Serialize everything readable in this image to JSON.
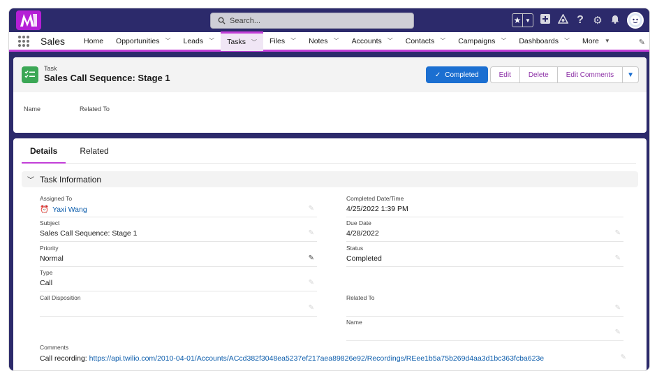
{
  "header": {
    "search_placeholder": "Search...",
    "icons": [
      "favorites-star-icon",
      "global-add-icon",
      "trailhead-icon",
      "help-icon",
      "setup-gear-icon",
      "notifications-bell-icon",
      "user-avatar"
    ]
  },
  "nav": {
    "app_name": "Sales",
    "items": [
      {
        "label": "Home",
        "dropdown": false
      },
      {
        "label": "Opportunities",
        "dropdown": true
      },
      {
        "label": "Leads",
        "dropdown": true
      },
      {
        "label": "Tasks",
        "dropdown": true,
        "active": true
      },
      {
        "label": "Files",
        "dropdown": true
      },
      {
        "label": "Notes",
        "dropdown": true
      },
      {
        "label": "Accounts",
        "dropdown": true
      },
      {
        "label": "Contacts",
        "dropdown": true
      },
      {
        "label": "Campaigns",
        "dropdown": true
      },
      {
        "label": "Dashboards",
        "dropdown": true
      },
      {
        "label": "More",
        "dropdown": true
      }
    ]
  },
  "record": {
    "object_label": "Task",
    "title": "Sales Call Sequence: Stage 1",
    "actions": {
      "completed": "Completed",
      "edit": "Edit",
      "delete": "Delete",
      "edit_comments": "Edit Comments"
    },
    "highlight_fields": [
      "Name",
      "Related To"
    ]
  },
  "tabs": [
    "Details",
    "Related"
  ],
  "section_title": "Task Information",
  "fields": {
    "assigned_to": {
      "label": "Assigned To",
      "value": "Yaxi Wang"
    },
    "subject": {
      "label": "Subject",
      "value": "Sales Call Sequence: Stage 1"
    },
    "priority": {
      "label": "Priority",
      "value": "Normal"
    },
    "type": {
      "label": "Type",
      "value": "Call"
    },
    "call_disposition": {
      "label": "Call Disposition",
      "value": ""
    },
    "completed_datetime": {
      "label": "Completed Date/Time",
      "value": "4/25/2022 1:39 PM"
    },
    "due_date": {
      "label": "Due Date",
      "value": "4/28/2022"
    },
    "status": {
      "label": "Status",
      "value": "Completed"
    },
    "related_to": {
      "label": "Related To",
      "value": ""
    },
    "name": {
      "label": "Name",
      "value": ""
    }
  },
  "comments": {
    "label": "Comments",
    "prefix": "Call recording: ",
    "link": "https://api.twilio.com/2010-04-01/Accounts/ACcd382f3048ea5237ef217aea89826e92/Recordings/REee1b5a75b269d4aa3d1bc363fcba623e"
  },
  "colors": {
    "brand_purple": "#c23fd8",
    "header_bg": "#2c2a6b",
    "primary_button": "#1b6fd1",
    "task_icon_green": "#3ba755",
    "link_blue": "#0b5cab"
  }
}
